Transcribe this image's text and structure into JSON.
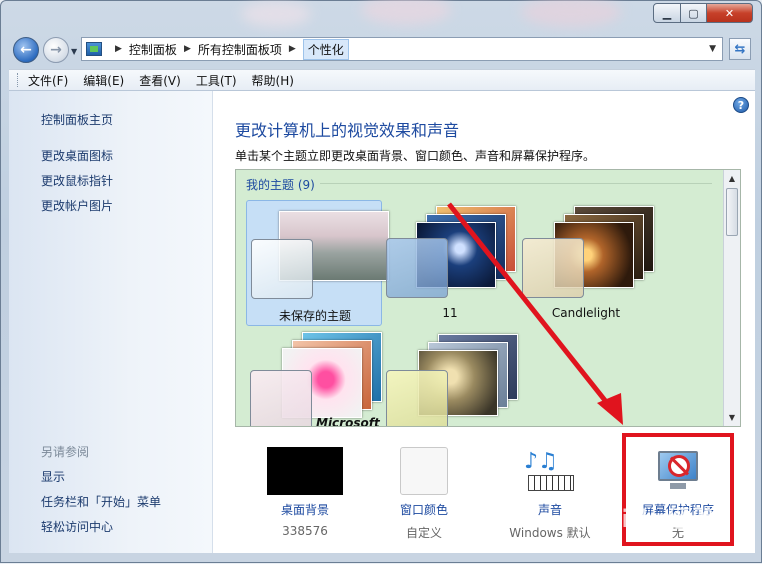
{
  "window": {
    "caption_buttons": [
      "minimize",
      "maximize",
      "close"
    ]
  },
  "address_bar": {
    "breadcrumbs": [
      "控制面板",
      "所有控制面板项",
      "个性化"
    ]
  },
  "menu": {
    "items": [
      "文件(F)",
      "编辑(E)",
      "查看(V)",
      "工具(T)",
      "帮助(H)"
    ]
  },
  "sidebar": {
    "links": [
      "控制面板主页",
      "更改桌面图标",
      "更改鼠标指针",
      "更改帐户图片"
    ],
    "see_also_heading": "另请参阅",
    "see_also_links": [
      "显示",
      "任务栏和「开始」菜单",
      "轻松访问中心"
    ]
  },
  "main": {
    "title": "更改计算机上的视觉效果和声音",
    "description": "单击某个主题立即更改桌面背景、窗口颜色、声音和屏幕保护程序。",
    "theme_group": "我的主题 (9)",
    "themes": [
      {
        "name": "未保存的主题",
        "selected": true
      },
      {
        "name": "11",
        "selected": false
      },
      {
        "name": "Candlelight",
        "selected": false
      },
      {
        "name": "",
        "selected": false
      },
      {
        "name": "",
        "selected": false
      }
    ],
    "microsoft_logo_text": "Microsoft"
  },
  "bottom": {
    "items": [
      {
        "label": "桌面背景",
        "value": "338576"
      },
      {
        "label": "窗口颜色",
        "value": "自定义"
      },
      {
        "label": "声音",
        "value": "Windows 默认"
      },
      {
        "label": "屏幕保护程序",
        "value": "无"
      }
    ]
  },
  "watermark": "Baidu经验",
  "colors": {
    "link": "#1d4aa0",
    "annotation_red": "#e0141e",
    "theme_bg": "#d4ecd2"
  }
}
